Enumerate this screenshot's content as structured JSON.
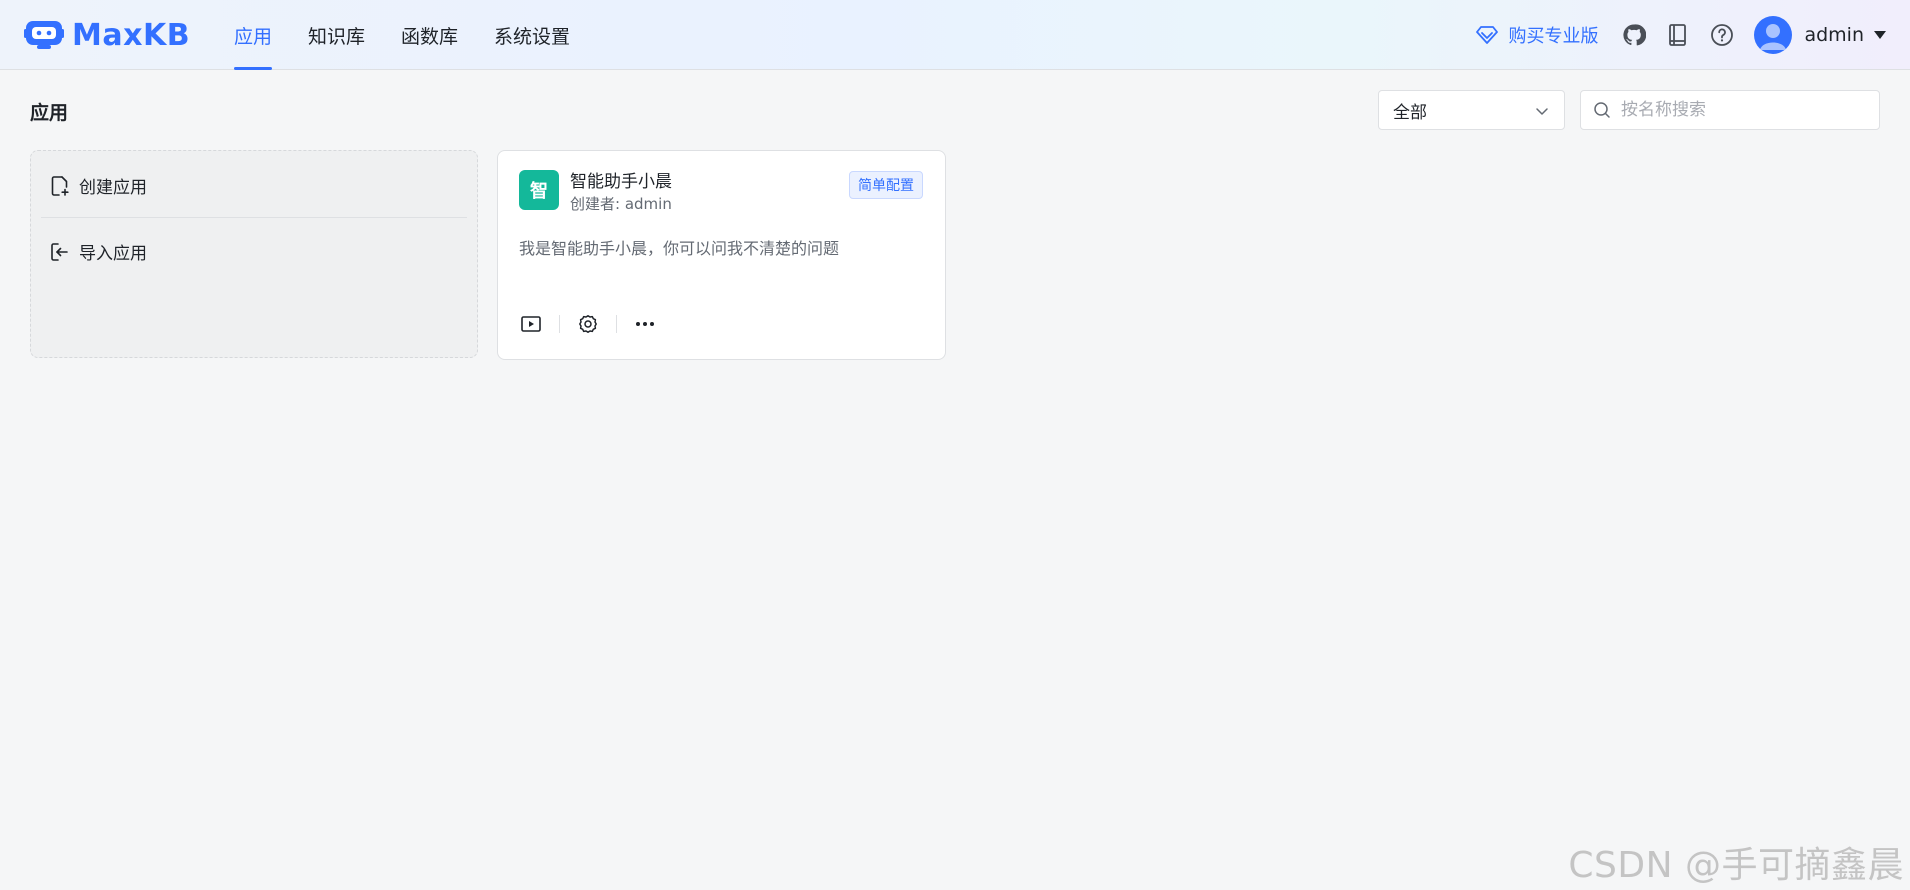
{
  "header": {
    "brand": "MaxKB",
    "nav": [
      {
        "label": "应用",
        "active": true
      },
      {
        "label": "知识库",
        "active": false
      },
      {
        "label": "函数库",
        "active": false
      },
      {
        "label": "系统设置",
        "active": false
      }
    ],
    "buy_pro": "购买专业版",
    "icons": [
      "diamond-icon",
      "github-icon",
      "book-icon",
      "help-icon"
    ],
    "username": "admin"
  },
  "page": {
    "title": "应用",
    "filter_value": "全部",
    "search_placeholder": "按名称搜索"
  },
  "create_card": {
    "create_label": "创建应用",
    "import_label": "导入应用"
  },
  "apps": [
    {
      "avatar_char": "智",
      "name": "智能助手小晨",
      "creator": "创建者: admin",
      "tag": "简单配置",
      "description": "我是智能助手小晨，你可以问我不清楚的问题"
    }
  ],
  "watermark": "CSDN @手可摘鑫晨",
  "colors": {
    "primary": "#3370ff",
    "app_avatar": "#14b89a",
    "background": "#f5f6f7"
  }
}
